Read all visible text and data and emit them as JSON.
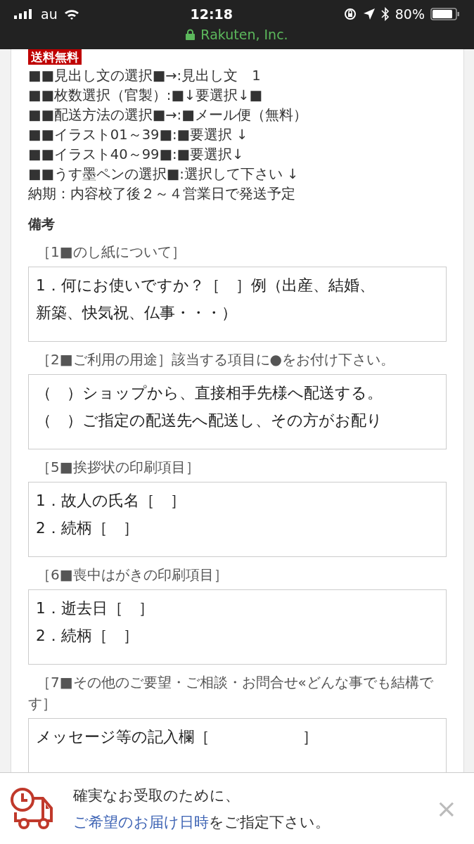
{
  "status_bar": {
    "carrier": "au",
    "time": "12:18",
    "battery": "80%",
    "site": "Rakuten, Inc."
  },
  "badge": "送料無料",
  "options": [
    "■■見出し文の選択■→:見出し文　1",
    "■■枚数選択（官製）:■↓要選択↓■",
    "■■配送方法の選択■→:■メール便（無料）",
    "■■イラスト01～39■:■要選択 ↓",
    "■■イラスト40～99■:■要選択↓",
    "■■うす墨ペンの選択■:選択して下さい ↓"
  ],
  "delivery_note": "納期：内容校了後２～４営業日で発送予定",
  "remarks_heading": "備考",
  "sections": [
    {
      "label": "［1■のし紙について］",
      "lines": [
        "1．何にお使いですか？［　］例（出産、結婚、",
        "新築、快気祝、仏事・・・）"
      ]
    },
    {
      "label": "［2■ご利用の用途］該当する項目に●をお付け下さい。",
      "lines": [
        "（　）ショップから、直接相手先様へ配送する。",
        "（　）ご指定の配送先へ配送し、その方がお配り"
      ]
    },
    {
      "label": "［5■挨拶状の印刷項目］",
      "lines": [
        "1．故人の氏名［　］",
        "2．続柄［　］"
      ]
    },
    {
      "label": "［6■喪中はがきの印刷項目］",
      "lines": [
        "1．逝去日［　］",
        "2．続柄［　］"
      ]
    },
    {
      "label": "［7■その他のご要望・ご相談・お問合せ«どんな事でも結構です］",
      "lines": [
        "メッセージ等の記入欄［　　　　　　］"
      ]
    }
  ],
  "banner": {
    "line": "確実なお受取のために、",
    "link": "ご希望のお届け日時",
    "link_suffix": "をご指定下さい。",
    "close": "×"
  }
}
